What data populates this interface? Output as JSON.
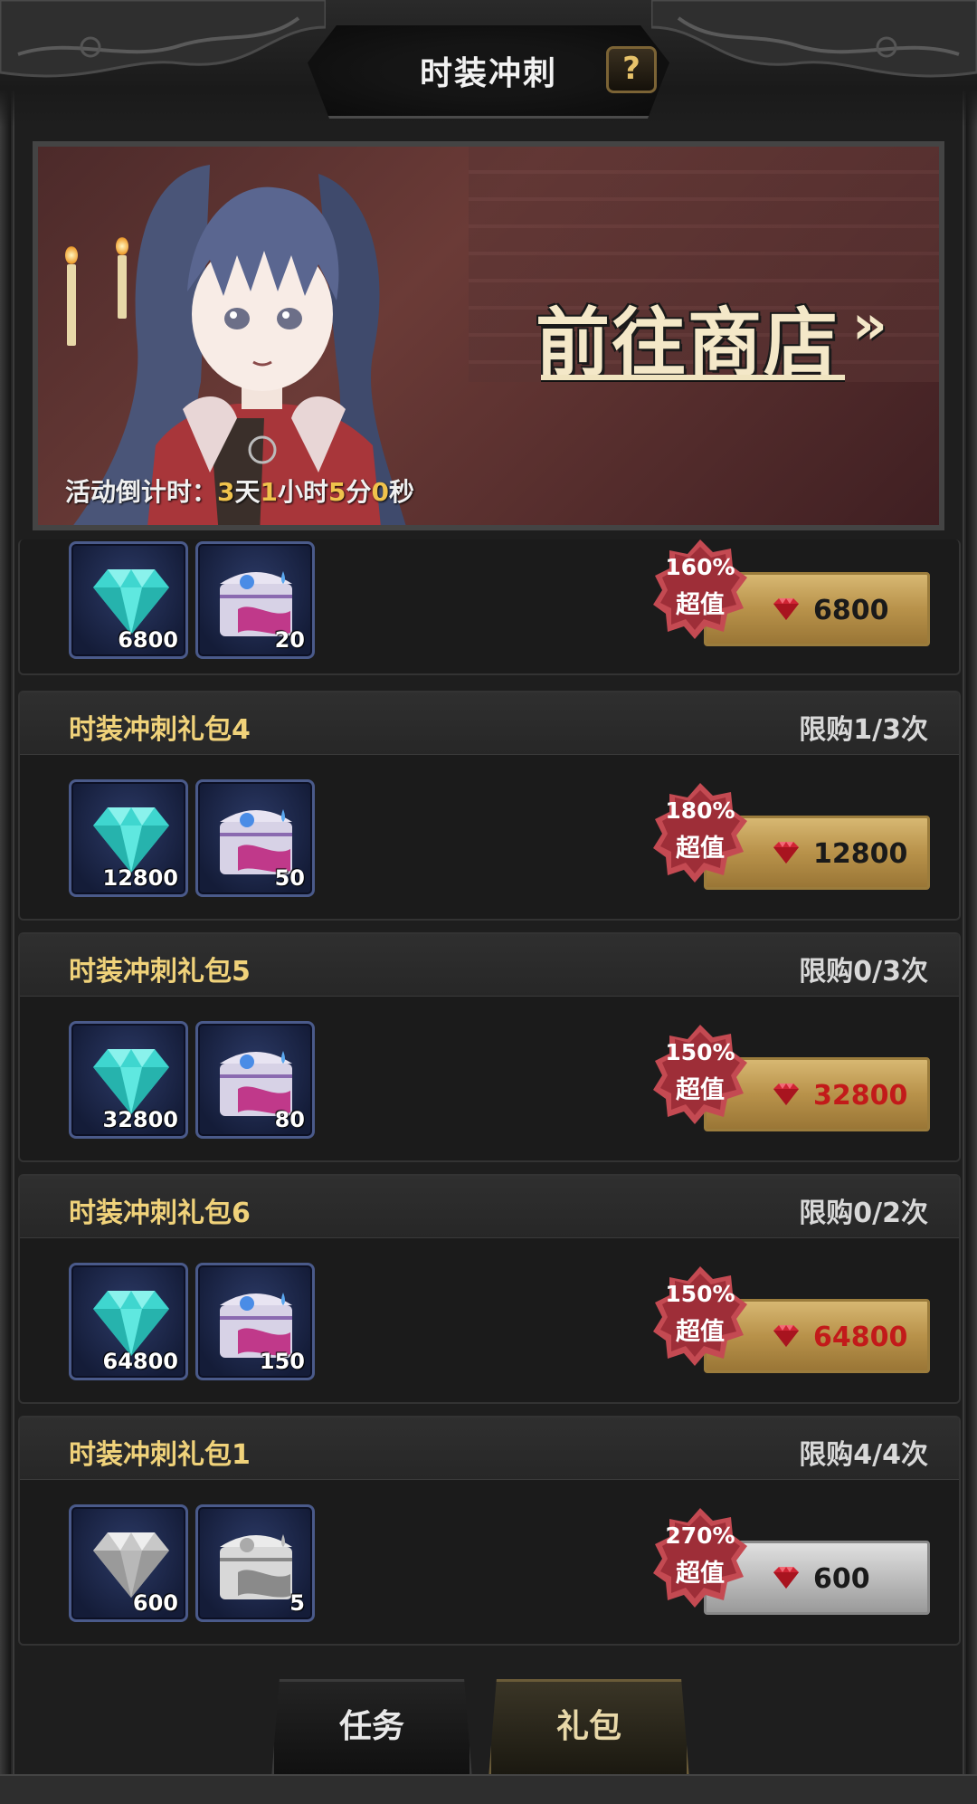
{
  "header": {
    "title": "时装冲刺",
    "help_label": "?"
  },
  "banner": {
    "shop_label": "前往商店",
    "shop_arrow": "»",
    "countdown": {
      "prefix": "活动倒计时：",
      "days": "3",
      "days_unit": "天",
      "hours": "1",
      "hours_unit": "小时",
      "minutes": "5",
      "minutes_unit": "分",
      "seconds": "0",
      "seconds_unit": "秒"
    }
  },
  "packages": [
    {
      "name": "",
      "limit": "",
      "items": [
        {
          "icon": "diamond-icon",
          "qty": "6800"
        },
        {
          "icon": "costume-chest-icon",
          "qty": "20"
        }
      ],
      "badge_pct": "160%",
      "badge_label": "超值",
      "price": "6800",
      "price_style": "normal"
    },
    {
      "name": "时装冲刺礼包4",
      "limit": "限购1/3次",
      "items": [
        {
          "icon": "diamond-icon",
          "qty": "12800"
        },
        {
          "icon": "costume-chest-icon",
          "qty": "50"
        }
      ],
      "badge_pct": "180%",
      "badge_label": "超值",
      "price": "12800",
      "price_style": "normal"
    },
    {
      "name": "时装冲刺礼包5",
      "limit": "限购0/3次",
      "items": [
        {
          "icon": "diamond-icon",
          "qty": "32800"
        },
        {
          "icon": "costume-chest-icon",
          "qty": "80"
        }
      ],
      "badge_pct": "150%",
      "badge_label": "超值",
      "price": "32800",
      "price_style": "red"
    },
    {
      "name": "时装冲刺礼包6",
      "limit": "限购0/2次",
      "items": [
        {
          "icon": "diamond-icon",
          "qty": "64800"
        },
        {
          "icon": "costume-chest-icon",
          "qty": "150"
        }
      ],
      "badge_pct": "150%",
      "badge_label": "超值",
      "price": "64800",
      "price_style": "red"
    },
    {
      "name": "时装冲刺礼包1",
      "limit": "限购4/4次",
      "items": [
        {
          "icon": "diamond-grey-icon",
          "qty": "600"
        },
        {
          "icon": "costume-chest-grey-icon",
          "qty": "5"
        }
      ],
      "badge_pct": "270%",
      "badge_label": "超值",
      "price": "600",
      "price_style": "disabled"
    }
  ],
  "tabs": [
    {
      "label": "任务",
      "active": false
    },
    {
      "label": "礼包",
      "active": true
    }
  ],
  "colors": {
    "gold_text": "#f0d27a",
    "price_red": "#c21a1a",
    "countdown_num": "#f0c24c"
  }
}
